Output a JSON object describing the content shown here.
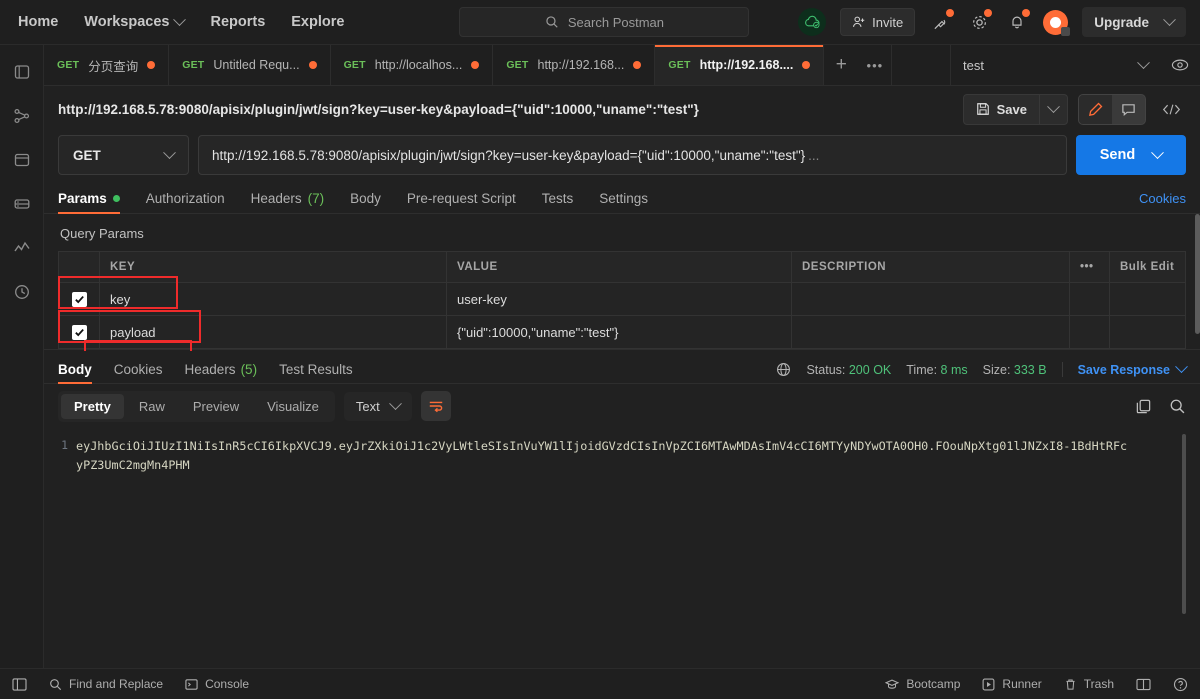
{
  "topnav": {
    "items": [
      {
        "label": "Home",
        "caret": false
      },
      {
        "label": "Workspaces",
        "caret": true
      },
      {
        "label": "Reports",
        "caret": false
      },
      {
        "label": "Explore",
        "caret": false
      }
    ],
    "search_placeholder": "Search Postman",
    "invite_label": "Invite",
    "upgrade_label": "Upgrade",
    "icons": [
      "cloud-check-icon",
      "invite-icon",
      "satellite-icon",
      "gear-icon",
      "bell-icon",
      "avatar"
    ]
  },
  "sidebar": {
    "items": [
      {
        "name": "collections-icon"
      },
      {
        "name": "apis-icon"
      },
      {
        "name": "environments-icon"
      },
      {
        "name": "mock-servers-icon"
      },
      {
        "name": "monitors-icon"
      },
      {
        "name": "history-icon"
      }
    ]
  },
  "tabs": {
    "items": [
      {
        "method": "GET",
        "label": "分页查询",
        "unsaved": true,
        "active": false
      },
      {
        "method": "GET",
        "label": "Untitled Requ...",
        "unsaved": true,
        "active": false
      },
      {
        "method": "GET",
        "label": "http://localhos...",
        "unsaved": true,
        "active": false
      },
      {
        "method": "GET",
        "label": "http://192.168...",
        "unsaved": true,
        "active": false
      },
      {
        "method": "GET",
        "label": "http://192.168....",
        "unsaved": true,
        "active": true
      }
    ],
    "add_label": "+",
    "more_label": "•••",
    "environment": "test"
  },
  "request": {
    "title": "http://192.168.5.78:9080/apisix/plugin/jwt/sign?key=user-key&payload={\"uid\":10000,\"uname\":\"test\"}",
    "save_label": "Save",
    "method": "GET",
    "url": "http://192.168.5.78:9080/apisix/plugin/jwt/sign?key=user-key&payload={\"uid\":10000,\"uname\":\"test\"}",
    "url_ellipsis": "...",
    "send_label": "Send",
    "tabs": [
      {
        "label": "Params",
        "active": true,
        "dot": true,
        "count": ""
      },
      {
        "label": "Authorization",
        "active": false,
        "dot": false,
        "count": ""
      },
      {
        "label": "Headers",
        "active": false,
        "dot": false,
        "count": "(7)"
      },
      {
        "label": "Body",
        "active": false,
        "dot": false,
        "count": ""
      },
      {
        "label": "Pre-request Script",
        "active": false,
        "dot": false,
        "count": ""
      },
      {
        "label": "Tests",
        "active": false,
        "dot": false,
        "count": ""
      },
      {
        "label": "Settings",
        "active": false,
        "dot": false,
        "count": ""
      }
    ],
    "cookies_link": "Cookies"
  },
  "params": {
    "section_title": "Query Params",
    "headers": {
      "key": "KEY",
      "value": "VALUE",
      "description": "DESCRIPTION",
      "more": "•••",
      "bulk_edit": "Bulk Edit"
    },
    "rows": [
      {
        "enabled": true,
        "key": "key",
        "value": "user-key",
        "description": ""
      },
      {
        "enabled": true,
        "key": "payload",
        "value": "{\"uid\":10000,\"uname\":\"test\"}",
        "description": ""
      }
    ]
  },
  "response": {
    "tabs": [
      {
        "label": "Body",
        "active": true,
        "count": ""
      },
      {
        "label": "Cookies",
        "active": false,
        "count": ""
      },
      {
        "label": "Headers",
        "active": false,
        "count": "(5)"
      },
      {
        "label": "Test Results",
        "active": false,
        "count": ""
      }
    ],
    "status_label": "Status:",
    "status_value": "200 OK",
    "time_label": "Time:",
    "time_value": "8 ms",
    "size_label": "Size:",
    "size_value": "333 B",
    "save_response": "Save Response",
    "view_modes": [
      {
        "label": "Pretty",
        "active": true
      },
      {
        "label": "Raw",
        "active": false
      },
      {
        "label": "Preview",
        "active": false
      },
      {
        "label": "Visualize",
        "active": false
      }
    ],
    "format": "Text",
    "line_number": "1",
    "body": "eyJhbGciOiJIUzI1NiIsInR5cCI6IkpXVCJ9.eyJrZXkiOiJ1c2VyLWtleSIsInVuYW1lIjoidGVzdCIsInVpZCI6MTAwMDAsImV4cCI6MTYyNDYwOTA0OH0.FOouNpXtg01lJNZxI8-1BdHtRFcyPZ3UmC2mgMn4PHM"
  },
  "footer": {
    "left": [
      {
        "label": "Find and Replace",
        "icon": "search-icon"
      },
      {
        "label": "Console",
        "icon": "console-icon"
      }
    ],
    "right": [
      {
        "label": "Bootcamp",
        "icon": "bootcamp-icon"
      },
      {
        "label": "Runner",
        "icon": "runner-icon"
      },
      {
        "label": "Trash",
        "icon": "trash-icon"
      }
    ]
  },
  "colors": {
    "accent": "#ff6c37",
    "send": "#1578e6",
    "success": "#4fc27a",
    "link": "#3f92f5",
    "highlight": "#ef2b2b"
  }
}
